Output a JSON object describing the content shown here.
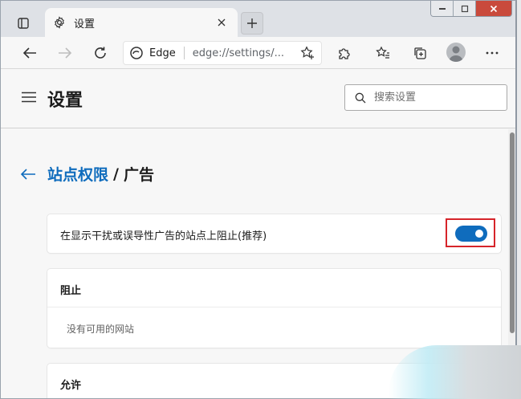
{
  "tab": {
    "title": "设置"
  },
  "address": {
    "site": "Edge",
    "url": "edge://settings/..."
  },
  "header": {
    "title": "设置",
    "search_placeholder": "搜索设置"
  },
  "breadcrumb": {
    "parent": "站点权限",
    "separator": "/",
    "current": "广告"
  },
  "toggle_setting": {
    "label": "在显示干扰或误导性广告的站点上阻止(推荐)",
    "enabled": true
  },
  "block_section": {
    "title": "阻止",
    "empty_text": "没有可用的网站"
  },
  "allow_section": {
    "title": "允许"
  },
  "colors": {
    "accent": "#0f6cbd",
    "highlight": "#d6242a"
  }
}
